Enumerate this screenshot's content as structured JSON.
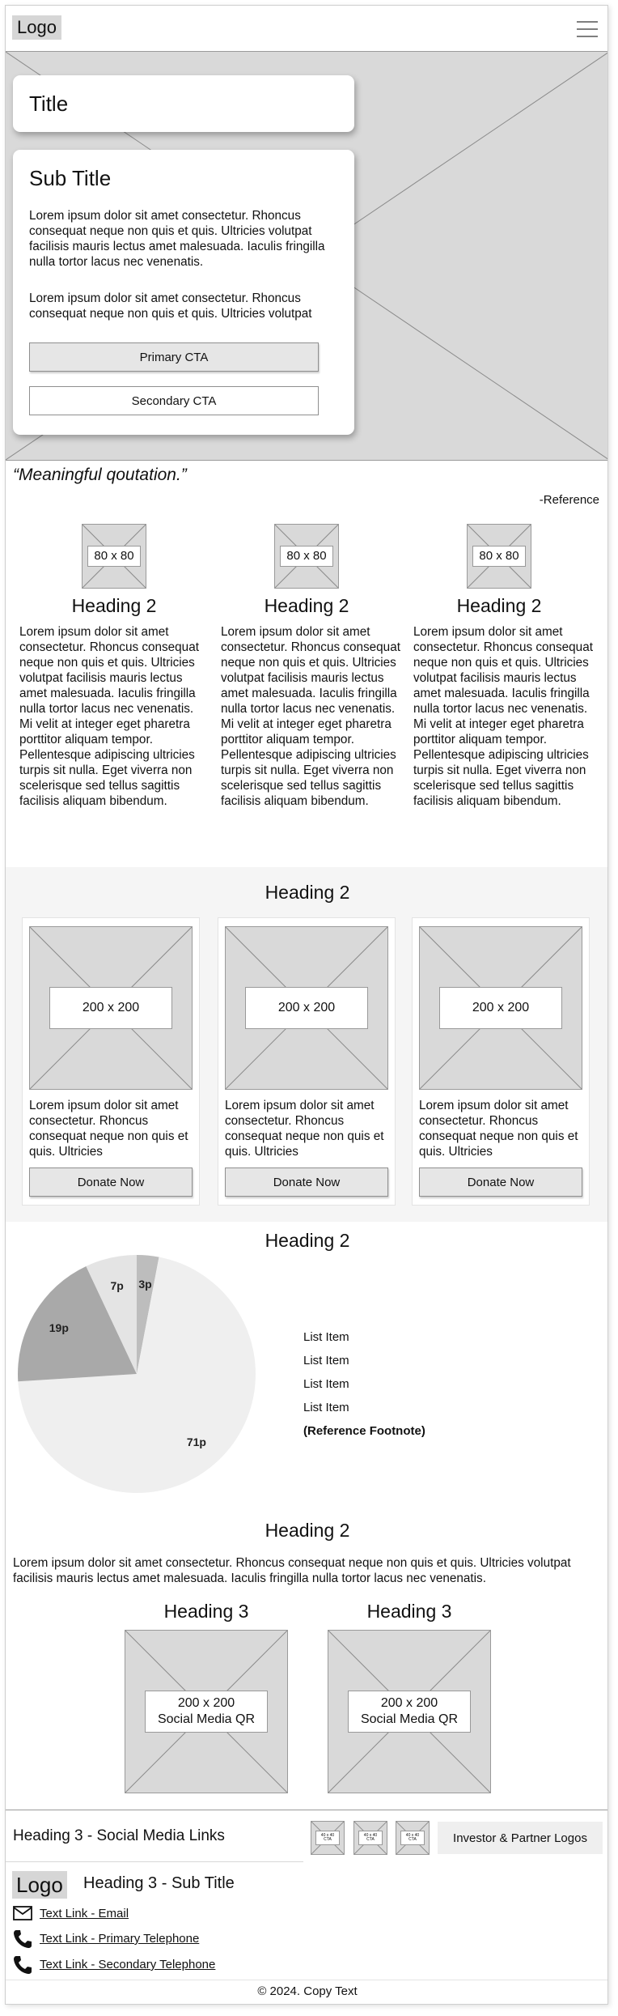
{
  "header": {
    "logo": "Logo"
  },
  "hero": {
    "title": "Title",
    "subtitle": "Sub Title",
    "para1": "Lorem ipsum dolor sit amet consectetur. Rhoncus consequat neque non quis et quis. Ultricies volutpat facilisis mauris lectus amet malesuada. Iaculis fringilla nulla tortor lacus nec venenatis.",
    "para2": "Lorem ipsum dolor sit amet consectetur. Rhoncus consequat neque non quis et quis. Ultricies volutpat",
    "primary_cta": "Primary CTA",
    "secondary_cta": "Secondary CTA"
  },
  "quote": {
    "text": "“Meaningful qoutation.”",
    "reference": "-Reference"
  },
  "features": {
    "image_label": "80 x 80",
    "items": [
      {
        "heading": "Heading 2",
        "text": "Lorem ipsum dolor sit amet consectetur. Rhoncus consequat neque non quis et quis. Ultricies volutpat facilisis mauris lectus amet malesuada. Iaculis fringilla nulla tortor lacus nec venenatis. Mi velit at integer eget pharetra porttitor aliquam tempor. Pellentesque adipiscing ultricies turpis sit nulla. Eget viverra non scelerisque sed tellus sagittis facilisis aliquam bibendum."
      },
      {
        "heading": "Heading 2",
        "text": "Lorem ipsum dolor sit amet consectetur. Rhoncus consequat neque non quis et quis. Ultricies volutpat facilisis mauris lectus amet malesuada. Iaculis fringilla nulla tortor lacus nec venenatis. Mi velit at integer eget pharetra porttitor aliquam tempor. Pellentesque adipiscing ultricies turpis sit nulla. Eget viverra non scelerisque sed tellus sagittis facilisis aliquam bibendum."
      },
      {
        "heading": "Heading 2",
        "text": "Lorem ipsum dolor sit amet consectetur. Rhoncus consequat neque non quis et quis. Ultricies volutpat facilisis mauris lectus amet malesuada. Iaculis fringilla nulla tortor lacus nec venenatis. Mi velit at integer eget pharetra porttitor aliquam tempor. Pellentesque adipiscing ultricies turpis sit nulla. Eget viverra non scelerisque sed tellus sagittis facilisis aliquam bibendum."
      }
    ]
  },
  "donate": {
    "heading": "Heading 2",
    "image_label": "200 x 200",
    "items": [
      {
        "text": "Lorem ipsum dolor sit amet consectetur. Rhoncus consequat neque non quis et quis. Ultricies",
        "button": "Donate Now"
      },
      {
        "text": "Lorem ipsum dolor sit amet consectetur. Rhoncus consequat neque non quis et quis. Ultricies",
        "button": "Donate Now"
      },
      {
        "text": "Lorem ipsum dolor sit amet consectetur. Rhoncus consequat neque non quis et quis. Ultricies",
        "button": "Donate Now"
      }
    ]
  },
  "stats": {
    "heading": "Heading 2",
    "list": [
      "List Item",
      "List Item",
      "List Item",
      "List Item"
    ],
    "footnote": "(Reference Footnote)"
  },
  "chart_data": {
    "type": "pie",
    "categories": [
      "3p",
      "71p",
      "19p",
      "7p"
    ],
    "values": [
      3,
      71,
      19,
      7
    ],
    "colors": [
      "#bdbdbd",
      "#efefef",
      "#a9a9a9",
      "#e4e4e4"
    ]
  },
  "social": {
    "heading": "Heading 2",
    "text": "Lorem ipsum dolor sit amet consectetur. Rhoncus consequat neque non quis et quis. Ultricies volutpat facilisis mauris lectus amet malesuada. Iaculis fringilla nulla tortor lacus nec venenatis.",
    "qr": [
      {
        "heading": "Heading 3",
        "label1": "200 x 200",
        "label2": "Social Media QR"
      },
      {
        "heading": "Heading 3",
        "label1": "200 x 200",
        "label2": "Social Media QR"
      }
    ]
  },
  "footer": {
    "social_heading": "Heading 3 - Social Media Links",
    "social_icon_label1": "40 x 40",
    "social_icon_label2": "CTA",
    "partners": "Investor & Partner Logos",
    "logo": "Logo",
    "subtitle": "Heading 3 - Sub Title",
    "email": "Text Link - Email",
    "phone1": "Text Link - Primary Telephone",
    "phone2": "Text Link - Secondary Telephone",
    "copyright": "© 2024. Copy Text"
  }
}
